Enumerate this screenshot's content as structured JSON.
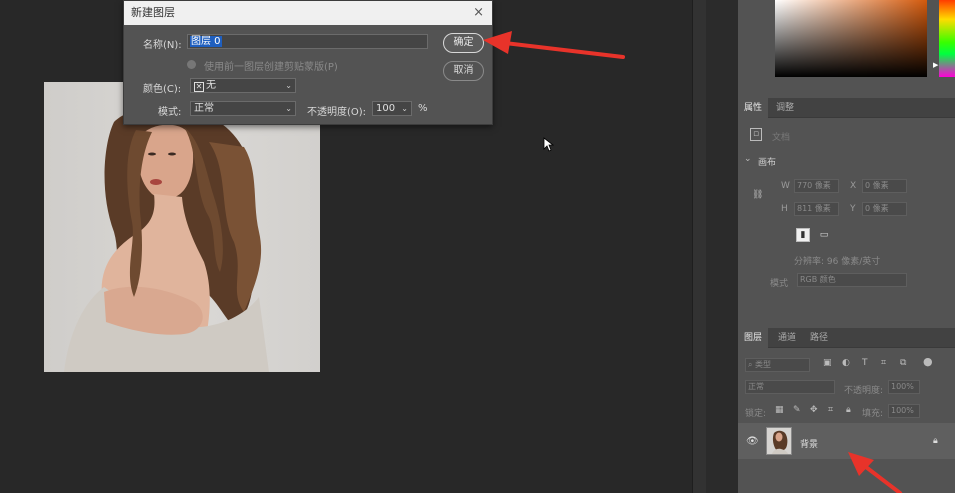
{
  "dialog": {
    "title": "新建图层",
    "close_symbol": "×",
    "name_label": "名称(N):",
    "name_value": "图层 0",
    "ok_label": "确定",
    "cancel_label": "取消",
    "clip_label": "使用前一图层创建剪贴蒙版(P)",
    "color_label": "颜色(C):",
    "color_value": "无",
    "mode_label": "模式:",
    "mode_value": "正常",
    "opacity_label": "不透明度(O):",
    "opacity_value": "100",
    "opacity_unit": "%"
  },
  "properties": {
    "tab_properties": "属性",
    "tab_adjustments": "调整",
    "doc_label": "文档",
    "canvas_label": "画布",
    "w_label": "W",
    "w_value": "770 像素",
    "h_label": "H",
    "h_value": "811 像素",
    "x_label": "X",
    "x_value": "0 像素",
    "y_label": "Y",
    "y_value": "0 像素",
    "resolution": "分辨率: 96 像素/英寸",
    "mode_label": "模式",
    "mode_value": "RGB 颜色"
  },
  "layers": {
    "tab_layers": "图层",
    "tab_channels": "通道",
    "tab_paths": "路径",
    "filter_placeholder": "类型",
    "blend_mode": "正常",
    "opacity_label": "不透明度:",
    "opacity_value": "100%",
    "lock_label": "锁定:",
    "fill_label": "填充:",
    "fill_value": "100%",
    "layer_name": "背景"
  },
  "colors": {
    "accent_arrow": "#e8332a",
    "selection": "#1f5fbf"
  }
}
